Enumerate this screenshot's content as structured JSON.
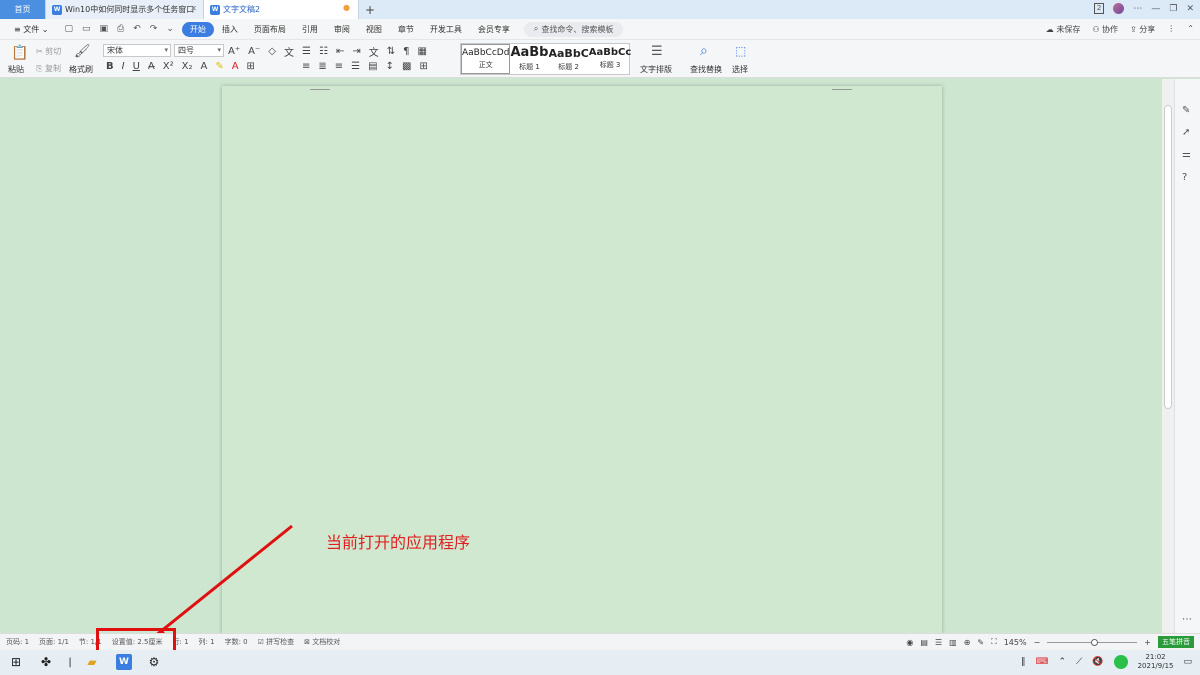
{
  "tabs": {
    "home": "首页",
    "doc1": "Win10中如何同时显示多个任务窗口",
    "doc2": "文字文稿2",
    "add": "+"
  },
  "window": {
    "badge": "2"
  },
  "menubar": {
    "file": "文件",
    "items": [
      "开始",
      "插入",
      "页面布局",
      "引用",
      "审阅",
      "视图",
      "章节",
      "开发工具",
      "会员专享"
    ],
    "search": "查找命令、搜索模板",
    "unsaved": "未保存",
    "collab": "协作",
    "share": "分享"
  },
  "ribbon": {
    "paste": "粘贴",
    "cut": "剪切",
    "copy": "复制",
    "format_painter": "格式刷",
    "font": "宋体",
    "size": "四号",
    "styles": [
      {
        "preview": "AaBbCcDd",
        "label": "正文"
      },
      {
        "preview": "AaBb",
        "label": "标题 1"
      },
      {
        "preview": "AaBbC",
        "label": "标题 2"
      },
      {
        "preview": "AaBbCc",
        "label": "标题 3"
      }
    ],
    "text_layout": "文字排版",
    "find_replace": "查找替换",
    "select": "选择"
  },
  "annotation": "当前打开的应用程序",
  "status": {
    "page": "页码: 1",
    "pages": "页面: 1/1",
    "section": "节: 1/1",
    "setting": "设置值: 2.5厘米",
    "row": "行: 1",
    "col": "列: 1",
    "words": "字数: 0",
    "spell": "拼写检查",
    "proof": "文档校对",
    "zoom": "145%",
    "ime": "五笔拼音"
  },
  "taskbar": {
    "time": "21:02",
    "date": "2021/9/15",
    "wps_label": "W"
  }
}
